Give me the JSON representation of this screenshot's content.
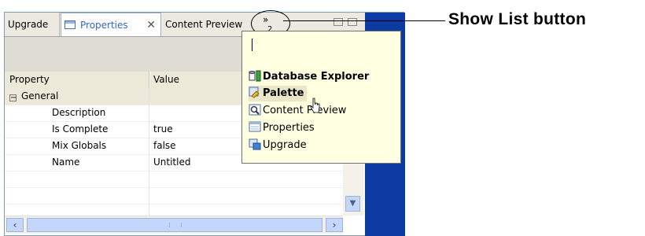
{
  "tabs": {
    "upgrade": "Upgrade",
    "properties": "Properties",
    "content_preview": "Content Preview",
    "overflow_count": "2",
    "close_glyph": "✕"
  },
  "grid": {
    "col_property": "Property",
    "col_value": "Value",
    "group": "General",
    "rows": [
      {
        "property": "Description",
        "value": ""
      },
      {
        "property": "Is Complete",
        "value": "true"
      },
      {
        "property": "Mix Globals",
        "value": "false"
      },
      {
        "property": "Name",
        "value": "Untitled"
      }
    ]
  },
  "popup": {
    "filter_value": "",
    "items": [
      {
        "label": "Database Explorer",
        "icon": "database-explorer-icon",
        "bold": true
      },
      {
        "label": "Palette",
        "icon": "palette-icon",
        "bold": true
      },
      {
        "label": "Content Preview",
        "icon": "content-preview-icon",
        "bold": false
      },
      {
        "label": "Properties",
        "icon": "properties-icon",
        "bold": false
      },
      {
        "label": "Upgrade",
        "icon": "upgrade-icon",
        "bold": false
      }
    ]
  },
  "callout": {
    "label": "Show List button"
  },
  "colors": {
    "side_panel": "#0b3aa3",
    "popup_bg": "#ffffe1",
    "accent": "#316ac5"
  }
}
